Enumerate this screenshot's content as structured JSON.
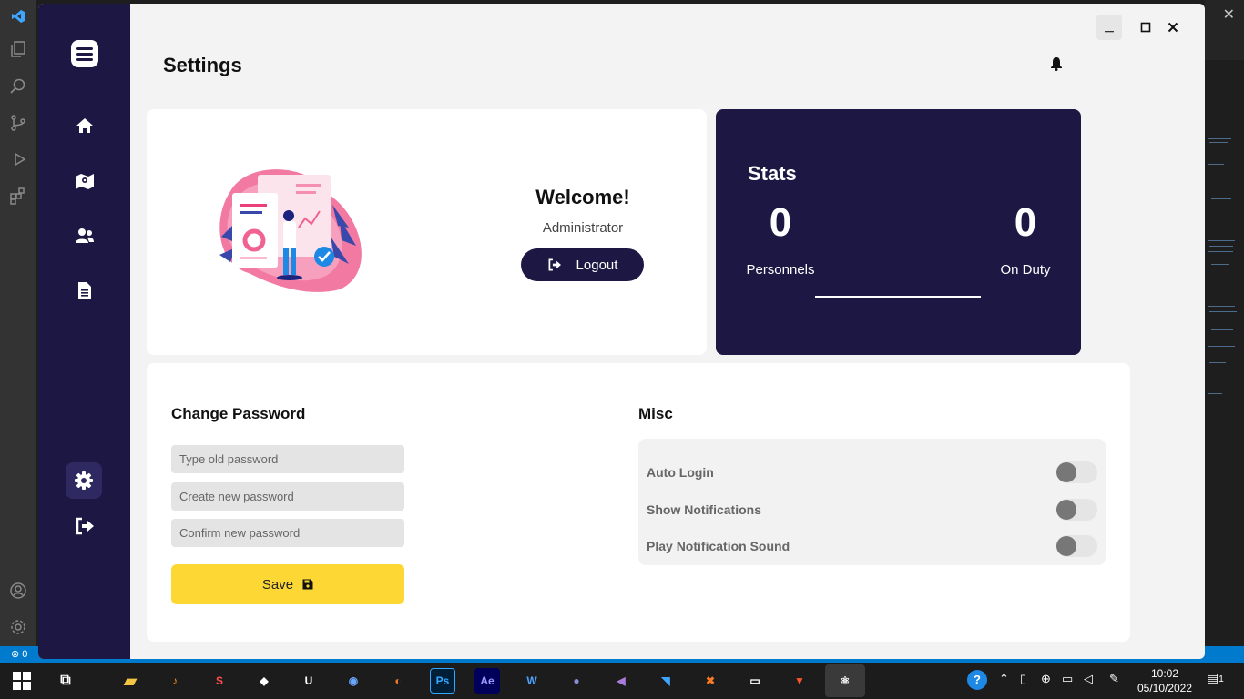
{
  "app": {
    "title": "Settings",
    "window_controls": {
      "minimize": "_",
      "maximize": "☐",
      "close": "✕"
    }
  },
  "sidebar": {
    "items": [
      {
        "name": "home",
        "icon": "home-icon"
      },
      {
        "name": "map",
        "icon": "map-icon"
      },
      {
        "name": "personnel",
        "icon": "users-icon"
      },
      {
        "name": "reports",
        "icon": "document-icon"
      },
      {
        "name": "settings",
        "icon": "gear-icon",
        "active": true
      },
      {
        "name": "logout",
        "icon": "logout-icon"
      }
    ]
  },
  "welcome": {
    "title": "Welcome!",
    "role": "Administrator",
    "logout_label": "Logout"
  },
  "stats": {
    "title": "Stats",
    "personnels_value": "0",
    "personnels_label": "Personnels",
    "on_duty_value": "0",
    "on_duty_label": "On Duty"
  },
  "change_password": {
    "title": "Change Password",
    "old_placeholder": "Type old password",
    "new_placeholder": "Create new password",
    "confirm_placeholder": "Confirm new password",
    "save_label": "Save"
  },
  "misc": {
    "title": "Misc",
    "options": [
      {
        "label": "Auto Login",
        "enabled": false
      },
      {
        "label": "Show Notifications",
        "enabled": false
      },
      {
        "label": "Play Notification Sound",
        "enabled": false
      }
    ]
  },
  "taskbar": {
    "time": "10:02",
    "date": "05/10/2022",
    "notification_count": "1"
  },
  "vscode_status": {
    "errors": "0"
  },
  "colors": {
    "sidebar": "#1d1744",
    "accent": "#fdd835",
    "background": "#f3f3f3"
  }
}
